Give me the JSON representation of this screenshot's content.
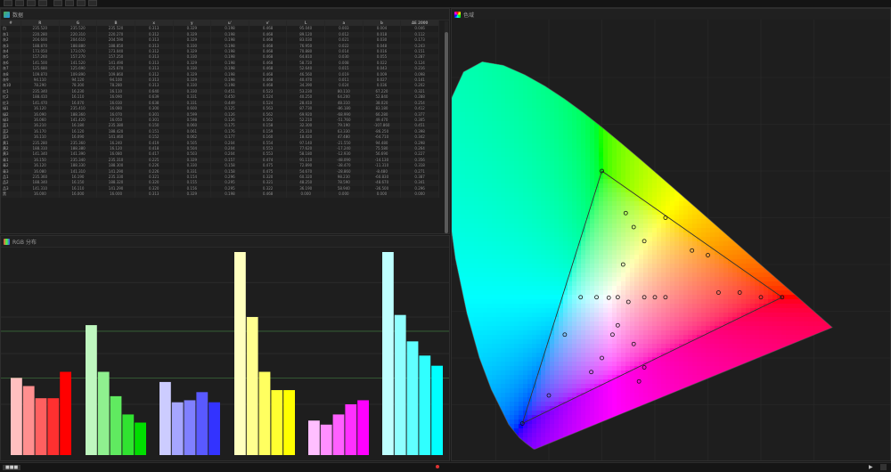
{
  "toolbar": {
    "buttons": [
      "new",
      "open",
      "save",
      "close",
      "undo",
      "redo",
      "refresh",
      "settings"
    ]
  },
  "data_panel": {
    "title": "数据",
    "icon": "table-icon",
    "columns": [
      "#",
      "R",
      "G",
      "B",
      "x",
      "y",
      "u'",
      "v'",
      "L",
      "a",
      "b",
      "ΔE 2000"
    ],
    "rows": [
      [
        "白",
        "235.520",
        "235.520",
        "235.520",
        "0.313",
        "0.329",
        "0.198",
        "0.468",
        "95.040",
        "0.003",
        "0.004",
        "0.046"
      ],
      [
        "灰1",
        "220.280",
        "220.310",
        "220.270",
        "0.312",
        "0.329",
        "0.198",
        "0.468",
        "89.120",
        "0.012",
        "0.018",
        "0.112"
      ],
      [
        "灰2",
        "204.600",
        "204.610",
        "204.590",
        "0.313",
        "0.329",
        "0.198",
        "0.468",
        "83.030",
        "0.021",
        "0.030",
        "0.173"
      ],
      [
        "灰3",
        "188.870",
        "188.880",
        "188.850",
        "0.313",
        "0.330",
        "0.198",
        "0.468",
        "76.950",
        "0.022",
        "0.048",
        "0.243"
      ],
      [
        "灰4",
        "173.050",
        "173.070",
        "173.040",
        "0.312",
        "0.329",
        "0.198",
        "0.468",
        "70.880",
        "0.014",
        "0.016",
        "0.151"
      ],
      [
        "灰5",
        "157.260",
        "157.270",
        "157.250",
        "0.313",
        "0.330",
        "0.198",
        "0.468",
        "64.810",
        "0.030",
        "0.055",
        "0.287"
      ],
      [
        "灰6",
        "141.500",
        "141.520",
        "141.490",
        "0.313",
        "0.329",
        "0.198",
        "0.468",
        "58.720",
        "0.008",
        "0.022",
        "0.124"
      ],
      [
        "灰7",
        "125.680",
        "125.690",
        "125.670",
        "0.313",
        "0.330",
        "0.198",
        "0.468",
        "52.640",
        "0.015",
        "0.043",
        "0.216"
      ],
      [
        "灰8",
        "109.870",
        "109.890",
        "109.860",
        "0.312",
        "0.329",
        "0.198",
        "0.468",
        "46.560",
        "0.019",
        "0.009",
        "0.098"
      ],
      [
        "灰9",
        "94.110",
        "94.120",
        "94.100",
        "0.313",
        "0.329",
        "0.198",
        "0.468",
        "40.470",
        "0.011",
        "0.027",
        "0.141"
      ],
      [
        "灰10",
        "78.290",
        "78.300",
        "78.280",
        "0.313",
        "0.330",
        "0.198",
        "0.468",
        "34.390",
        "0.024",
        "0.036",
        "0.202"
      ],
      [
        "红1",
        "235.340",
        "16.230",
        "16.110",
        "0.640",
        "0.330",
        "0.451",
        "0.523",
        "53.230",
        "80.110",
        "67.220",
        "0.321"
      ],
      [
        "红2",
        "188.410",
        "16.110",
        "16.090",
        "0.639",
        "0.331",
        "0.450",
        "0.524",
        "40.250",
        "64.200",
        "52.840",
        "0.288"
      ],
      [
        "红3",
        "141.470",
        "16.070",
        "16.030",
        "0.638",
        "0.331",
        "0.449",
        "0.524",
        "28.410",
        "48.310",
        "38.020",
        "0.254"
      ],
      [
        "绿1",
        "16.120",
        "235.410",
        "16.080",
        "0.300",
        "0.600",
        "0.125",
        "0.563",
        "87.730",
        "-86.180",
        "83.180",
        "0.412"
      ],
      [
        "绿2",
        "16.090",
        "188.360",
        "16.070",
        "0.301",
        "0.599",
        "0.126",
        "0.562",
        "69.920",
        "-68.990",
        "66.280",
        "0.377"
      ],
      [
        "绿3",
        "16.060",
        "141.420",
        "16.050",
        "0.301",
        "0.598",
        "0.126",
        "0.562",
        "52.210",
        "-51.760",
        "49.470",
        "0.305"
      ],
      [
        "蓝1",
        "16.210",
        "16.180",
        "235.380",
        "0.150",
        "0.060",
        "0.175",
        "0.158",
        "32.300",
        "79.190",
        "-107.860",
        "0.451"
      ],
      [
        "蓝2",
        "16.170",
        "16.120",
        "188.420",
        "0.151",
        "0.061",
        "0.176",
        "0.159",
        "25.310",
        "63.330",
        "-86.250",
        "0.398"
      ],
      [
        "蓝3",
        "16.110",
        "16.090",
        "141.460",
        "0.152",
        "0.062",
        "0.177",
        "0.160",
        "18.420",
        "47.480",
        "-64.710",
        "0.342"
      ],
      [
        "黄1",
        "235.280",
        "235.360",
        "16.240",
        "0.419",
        "0.505",
        "0.204",
        "0.554",
        "97.140",
        "-21.550",
        "94.480",
        "0.298"
      ],
      [
        "黄2",
        "188.310",
        "188.380",
        "16.120",
        "0.418",
        "0.504",
        "0.204",
        "0.553",
        "77.620",
        "-17.240",
        "75.580",
        "0.264"
      ],
      [
        "黄3",
        "141.340",
        "141.390",
        "16.080",
        "0.417",
        "0.503",
        "0.204",
        "0.553",
        "58.180",
        "-12.930",
        "56.690",
        "0.227"
      ],
      [
        "青1",
        "16.150",
        "235.340",
        "235.310",
        "0.225",
        "0.329",
        "0.157",
        "0.474",
        "91.110",
        "-48.090",
        "-14.130",
        "0.356"
      ],
      [
        "青2",
        "16.120",
        "188.330",
        "188.300",
        "0.226",
        "0.330",
        "0.158",
        "0.475",
        "72.890",
        "-38.470",
        "-11.310",
        "0.318"
      ],
      [
        "青3",
        "16.080",
        "141.310",
        "141.290",
        "0.226",
        "0.331",
        "0.158",
        "0.475",
        "54.670",
        "-28.860",
        "-8.480",
        "0.271"
      ],
      [
        "品1",
        "235.360",
        "16.190",
        "235.330",
        "0.321",
        "0.154",
        "0.296",
        "0.320",
        "60.320",
        "98.230",
        "-60.830",
        "0.387"
      ],
      [
        "品2",
        "188.340",
        "16.150",
        "188.320",
        "0.320",
        "0.155",
        "0.295",
        "0.321",
        "48.250",
        "78.590",
        "-48.670",
        "0.341"
      ],
      [
        "品3",
        "141.310",
        "16.110",
        "141.290",
        "0.320",
        "0.156",
        "0.295",
        "0.322",
        "36.190",
        "58.940",
        "-36.500",
        "0.296"
      ],
      [
        "黑",
        "16.000",
        "16.000",
        "16.000",
        "0.313",
        "0.329",
        "0.198",
        "0.468",
        "0.000",
        "0.000",
        "0.000",
        "0.000"
      ]
    ]
  },
  "bars_panel": {
    "title": "RGB 分布",
    "icon": "bar-chart-icon"
  },
  "gamut_panel": {
    "title": "色域",
    "icon": "chromaticity-icon"
  },
  "chart_data": [
    {
      "type": "bar",
      "title": "",
      "xlabel": "",
      "ylabel": "",
      "ylim": [
        0,
        100
      ],
      "groups": [
        {
          "color": "#ff0000",
          "values": [
            38,
            34,
            28,
            28,
            41
          ]
        },
        {
          "color": "#00dd00",
          "values": [
            64,
            41,
            29,
            20,
            16
          ]
        },
        {
          "color": "#3333ff",
          "values": [
            36,
            26,
            27,
            31,
            26
          ]
        },
        {
          "color": "#ffff00",
          "values": [
            100,
            68,
            41,
            32,
            32
          ]
        },
        {
          "color": "#ff00ff",
          "values": [
            17,
            15,
            20,
            25,
            27
          ]
        },
        {
          "color": "#00ffff",
          "values": [
            100,
            69,
            56,
            49,
            44
          ]
        }
      ]
    },
    {
      "type": "scatter",
      "title": "",
      "xlabel": "",
      "ylabel": "",
      "xlim": [
        0,
        0.8
      ],
      "ylim": [
        0,
        0.9
      ],
      "target_gamut": {
        "red": [
          0.64,
          0.33
        ],
        "green": [
          0.3,
          0.6
        ],
        "blue": [
          0.15,
          0.06
        ]
      },
      "measured_points": [
        [
          0.3,
          0.6
        ],
        [
          0.313,
          0.329
        ],
        [
          0.64,
          0.33
        ],
        [
          0.15,
          0.06
        ],
        [
          0.345,
          0.51
        ],
        [
          0.36,
          0.48
        ],
        [
          0.38,
          0.45
        ],
        [
          0.42,
          0.5
        ],
        [
          0.47,
          0.43
        ],
        [
          0.5,
          0.42
        ],
        [
          0.52,
          0.34
        ],
        [
          0.56,
          0.34
        ],
        [
          0.6,
          0.33
        ],
        [
          0.38,
          0.33
        ],
        [
          0.4,
          0.33
        ],
        [
          0.42,
          0.33
        ],
        [
          0.35,
          0.32
        ],
        [
          0.33,
          0.33
        ],
        [
          0.29,
          0.33
        ],
        [
          0.26,
          0.33
        ],
        [
          0.32,
          0.25
        ],
        [
          0.33,
          0.27
        ],
        [
          0.3,
          0.2
        ],
        [
          0.28,
          0.17
        ],
        [
          0.38,
          0.18
        ],
        [
          0.36,
          0.23
        ],
        [
          0.37,
          0.15
        ],
        [
          0.2,
          0.12
        ],
        [
          0.23,
          0.25
        ],
        [
          0.34,
          0.4
        ]
      ]
    }
  ]
}
